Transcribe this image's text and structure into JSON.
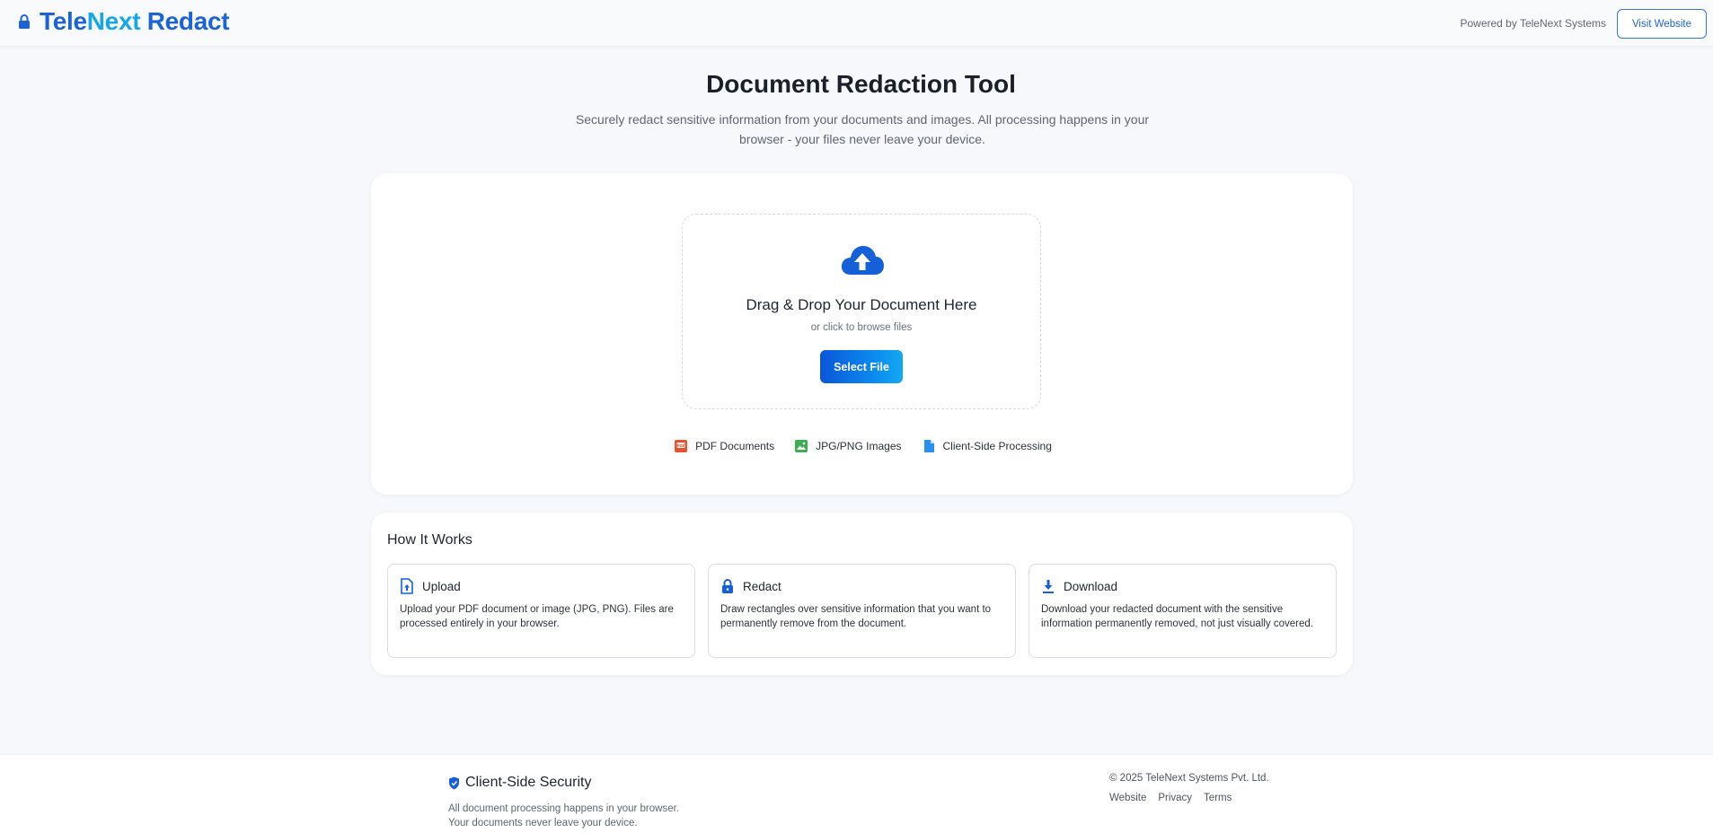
{
  "header": {
    "brand_parts": [
      "Tele",
      "Next",
      " Redact"
    ],
    "lock_icon": "lock-icon",
    "powered_by": "Powered by TeleNext Systems",
    "visit_button": "Visit Website"
  },
  "hero": {
    "title": "Document Redaction Tool",
    "subtitle": "Securely redact sensitive information from your documents and images. All processing happens in your browser - your files never leave your device."
  },
  "upload": {
    "icon": "cloud-upload-icon",
    "title": "Drag & Drop Your Document Here",
    "subtitle": "or click to browse files",
    "button": "Select File",
    "features": [
      {
        "icon": "pdf-icon",
        "label": "PDF Documents",
        "color": "#e5532f"
      },
      {
        "icon": "image-icon",
        "label": "JPG/PNG Images",
        "color": "#3fae53"
      },
      {
        "icon": "file-icon",
        "label": "Client-Side Processing",
        "color": "#2b8ff0"
      }
    ]
  },
  "how_it_works": {
    "title": "How It Works",
    "steps": [
      {
        "icon": "file-upload-icon",
        "name": "Upload",
        "description": "Upload your PDF document or image (JPG, PNG). Files are processed entirely in your browser."
      },
      {
        "icon": "lock-icon",
        "name": "Redact",
        "description": "Draw rectangles over sensitive information that you want to permanently remove from the document."
      },
      {
        "icon": "download-icon",
        "name": "Download",
        "description": "Download your redacted document with the sensitive information permanently removed, not just visually covered."
      }
    ]
  },
  "footer": {
    "security_icon": "shield-icon",
    "security_title": "Client-Side Security",
    "security_line1": "All document processing happens in your browser.",
    "security_line2": "Your documents never leave your device.",
    "copyright": "© 2025 TeleNext Systems Pvt. Ltd.",
    "links": [
      "Website",
      "Privacy",
      "Terms"
    ]
  },
  "colors": {
    "primary": "#1c63d6",
    "accent": "#15a7e8",
    "background": "#f7f8fb"
  }
}
